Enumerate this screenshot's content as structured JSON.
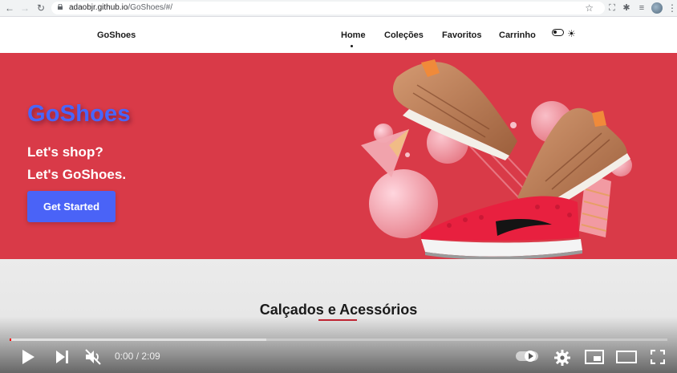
{
  "browser": {
    "url_host": "adaobjr.github.io",
    "url_path": "/GoShoes/#/"
  },
  "site": {
    "brand": "GoShoes",
    "nav": [
      {
        "label": "Home",
        "active": true
      },
      {
        "label": "Coleções"
      },
      {
        "label": "Favoritos"
      },
      {
        "label": "Carrinho"
      }
    ]
  },
  "hero": {
    "title": "GoShoes",
    "line1": "Let's shop?",
    "line2": "Let's GoShoes.",
    "cta": "Get Started"
  },
  "section": {
    "title": "Calçados e Acessórios"
  },
  "player": {
    "time": "0:00 / 2:09",
    "progress_played": 0.002,
    "progress_buffered": 0.39
  },
  "colors": {
    "hero_bg": "#d93a48",
    "brand_blue": "#4766ff",
    "cta_bg": "#4a63f7",
    "accent_red": "#c52433"
  }
}
